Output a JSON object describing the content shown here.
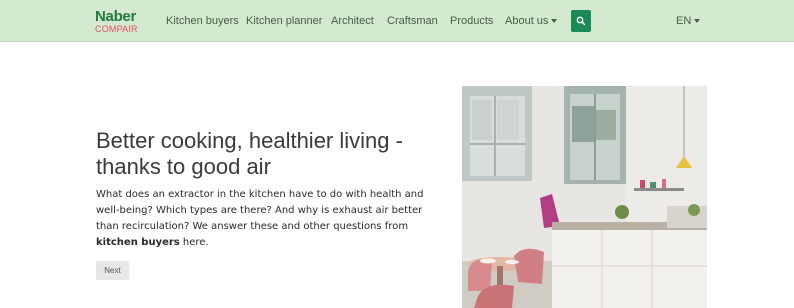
{
  "nav": {
    "logo_top": "Naber",
    "logo_bottom": "COMPAIR",
    "items": [
      "Kitchen buyers",
      "Kitchen planner",
      "Architect",
      "Craftsman",
      "Products"
    ],
    "about": "About us",
    "language": "EN",
    "search_icon": "search-icon"
  },
  "hero": {
    "headline_line1": "Better cooking, healthier living -",
    "headline_line2": "thanks to good air",
    "intro_text": "What does an extractor in the kitchen have to do with health and well-being? Which types are there? And why is exhaust air better than recirculation? We answer these and other questions from ",
    "intro_bold": "kitchen buyers",
    "intro_suffix": " here.",
    "next_label": "Next",
    "image_alt": "Bright kitchen with windows, white cabinets, pink chairs"
  },
  "colors": {
    "nav_bg": "#d4ead0",
    "brand_green": "#1f7a3b",
    "brand_red": "#e0515a",
    "search_bg": "#1c8a58"
  }
}
